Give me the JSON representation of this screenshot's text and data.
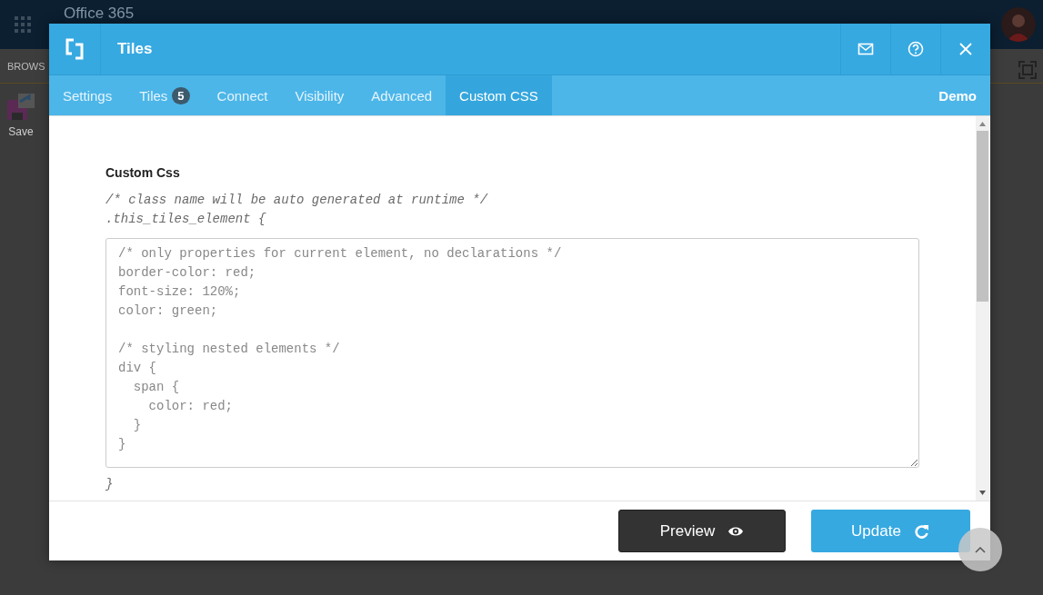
{
  "suite_bar": {
    "title": "Office 365"
  },
  "ribbon": {
    "tab": "BROWS",
    "button": "Save"
  },
  "dialog": {
    "title": "Tiles",
    "tabs": [
      {
        "label": "Settings",
        "selected": false
      },
      {
        "label": "Tiles",
        "badge": "5",
        "selected": false
      },
      {
        "label": "Connect",
        "selected": false
      },
      {
        "label": "Visibility",
        "selected": false
      },
      {
        "label": "Advanced",
        "selected": false
      },
      {
        "label": "Custom CSS",
        "selected": true
      }
    ],
    "mode": "Demo",
    "section_title": "Custom Css",
    "preamble": [
      "/* class name will be auto generated at runtime */",
      ".this_tiles_element {"
    ],
    "editor": {
      "value": "/* only properties for current element, no declarations */\nborder-color: red;\nfont-size: 120%;\ncolor: green;\n\n/* styling nested elements */\ndiv {\n  span {\n    color: red;\n  }\n}"
    },
    "closing": "}",
    "buttons": [
      {
        "label": "Preview",
        "kind": "preview"
      },
      {
        "label": "Update",
        "kind": "update"
      }
    ]
  }
}
